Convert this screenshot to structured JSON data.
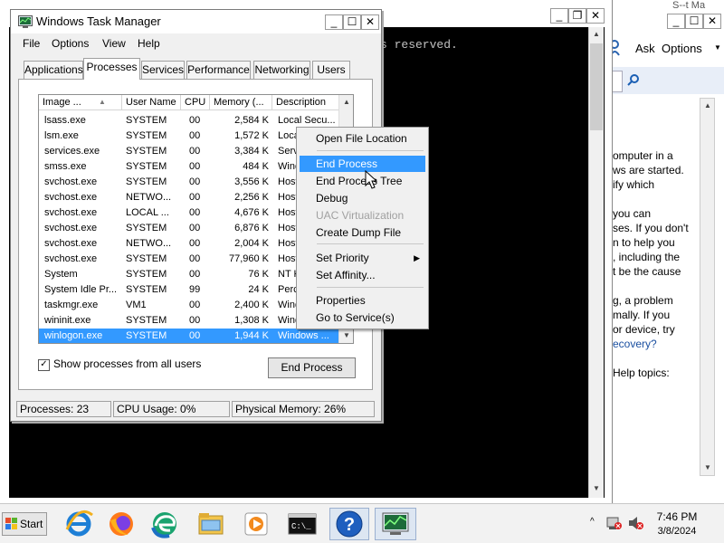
{
  "console": {
    "text": "s reserved."
  },
  "help": {
    "top_text": "S--t Ma",
    "toolbar": {
      "ask": "Ask",
      "options": "Options"
    },
    "body_lines": [
      {
        "text": "omputer in a",
        "link": false
      },
      {
        "text": "ws are started.",
        "link": false
      },
      {
        "text": "ify which",
        "link": false
      },
      {
        "text": "",
        "link": false
      },
      {
        "text": "you can",
        "link": false
      },
      {
        "text": "ses. If you don't",
        "link": false
      },
      {
        "text": "n to help you",
        "link": false
      },
      {
        "text": ", including the",
        "link": false
      },
      {
        "text": "t be the cause",
        "link": false
      },
      {
        "text": "",
        "link": false
      },
      {
        "text": "g, a problem",
        "link": false
      },
      {
        "text": "mally. If you",
        "link": false
      },
      {
        "text": "or device, try",
        "link": false
      },
      {
        "text": "ecovery?",
        "link": true
      },
      {
        "text": "",
        "link": false
      },
      {
        "text": "Help topics:",
        "link": false
      }
    ]
  },
  "task_manager": {
    "title": "Windows Task Manager",
    "menu": [
      "File",
      "Options",
      "View",
      "Help"
    ],
    "tabs": [
      "Applications",
      "Processes",
      "Services",
      "Performance",
      "Networking",
      "Users"
    ],
    "active_tab": "Processes",
    "columns": [
      "Image ...",
      "User Name",
      "CPU",
      "Memory (...",
      "Description"
    ],
    "processes": [
      {
        "image": "lsass.exe",
        "user": "SYSTEM",
        "cpu": "00",
        "mem": "2,584 K",
        "desc": "Local Secu..."
      },
      {
        "image": "lsm.exe",
        "user": "SYSTEM",
        "cpu": "00",
        "mem": "1,572 K",
        "desc": "Loca"
      },
      {
        "image": "services.exe",
        "user": "SYSTEM",
        "cpu": "00",
        "mem": "3,384 K",
        "desc": "Serv"
      },
      {
        "image": "smss.exe",
        "user": "SYSTEM",
        "cpu": "00",
        "mem": "484 K",
        "desc": "Wind"
      },
      {
        "image": "svchost.exe",
        "user": "SYSTEM",
        "cpu": "00",
        "mem": "3,556 K",
        "desc": "Host"
      },
      {
        "image": "svchost.exe",
        "user": "NETWO...",
        "cpu": "00",
        "mem": "2,256 K",
        "desc": "Host"
      },
      {
        "image": "svchost.exe",
        "user": "LOCAL ...",
        "cpu": "00",
        "mem": "4,676 K",
        "desc": "Host"
      },
      {
        "image": "svchost.exe",
        "user": "SYSTEM",
        "cpu": "00",
        "mem": "6,876 K",
        "desc": "Host"
      },
      {
        "image": "svchost.exe",
        "user": "NETWO...",
        "cpu": "00",
        "mem": "2,004 K",
        "desc": "Host"
      },
      {
        "image": "svchost.exe",
        "user": "SYSTEM",
        "cpu": "00",
        "mem": "77,960 K",
        "desc": "Host"
      },
      {
        "image": "System",
        "user": "SYSTEM",
        "cpu": "00",
        "mem": "76 K",
        "desc": "NT K"
      },
      {
        "image": "System Idle Pr...",
        "user": "SYSTEM",
        "cpu": "99",
        "mem": "24 K",
        "desc": "Perc"
      },
      {
        "image": "taskmgr.exe",
        "user": "VM1",
        "cpu": "00",
        "mem": "2,400 K",
        "desc": "Wind"
      },
      {
        "image": "wininit.exe",
        "user": "SYSTEM",
        "cpu": "00",
        "mem": "1,308 K",
        "desc": "Wind"
      },
      {
        "image": "winlogon.exe",
        "user": "SYSTEM",
        "cpu": "00",
        "mem": "1,944 K",
        "desc": "Windows ..."
      }
    ],
    "selected_index": 14,
    "show_all_label": "Show processes from all users",
    "show_all_checked": true,
    "end_process_label": "End Process",
    "status": {
      "processes": "Processes: 23",
      "cpu": "CPU Usage: 0%",
      "memory": "Physical Memory: 26%"
    }
  },
  "context_menu": {
    "items": [
      {
        "label": "Open File Location",
        "state": "normal",
        "submenu": false
      },
      {
        "label": "End Process",
        "state": "highlighted",
        "submenu": false
      },
      {
        "label": "End Process Tree",
        "state": "normal",
        "submenu": false
      },
      {
        "label": "Debug",
        "state": "normal",
        "submenu": false
      },
      {
        "label": "UAC Virtualization",
        "state": "disabled",
        "submenu": false
      },
      {
        "label": "Create Dump File",
        "state": "normal",
        "submenu": false
      },
      {
        "label": "Set Priority",
        "state": "normal",
        "submenu": true
      },
      {
        "label": "Set Affinity...",
        "state": "normal",
        "submenu": false
      },
      {
        "label": "Properties",
        "state": "normal",
        "submenu": false
      },
      {
        "label": "Go to Service(s)",
        "state": "normal",
        "submenu": false
      }
    ]
  },
  "taskbar": {
    "start_label": "Start",
    "apps": [
      "internet-explorer-icon",
      "firefox-icon",
      "edge-icon",
      "file-explorer-icon",
      "media-player-icon",
      "command-prompt-icon",
      "help-icon",
      "task-manager-icon"
    ],
    "active_app": "help-icon",
    "time": "7:46 PM",
    "date": "3/8/2024"
  },
  "colors": {
    "selection": "#3399ff",
    "link": "#1a4fa0"
  }
}
